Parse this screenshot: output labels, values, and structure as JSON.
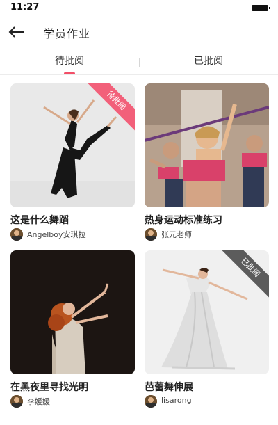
{
  "status_bar": {
    "time": "11:27"
  },
  "header": {
    "title": "学员作业",
    "back_icon": "arrow-left-icon"
  },
  "tabs": [
    {
      "label": "待批阅",
      "active": true
    },
    {
      "label": "已批阅",
      "active": false
    }
  ],
  "colors": {
    "accent": "#f24f68",
    "ribbon_pending": "#f2607a",
    "ribbon_reviewed": "#5c5c5c"
  },
  "cards": [
    {
      "title": "这是什么舞蹈",
      "author": "Angelboy安琪拉",
      "badge": "待批阅"
    },
    {
      "title": "热身运动标准练习",
      "author": "张元老师",
      "badge": ""
    },
    {
      "title": "在黑夜里寻找光明",
      "author": "李媛媛",
      "badge": ""
    },
    {
      "title": "芭蕾舞伸展",
      "author": "lisarong",
      "badge": "已批阅"
    }
  ]
}
